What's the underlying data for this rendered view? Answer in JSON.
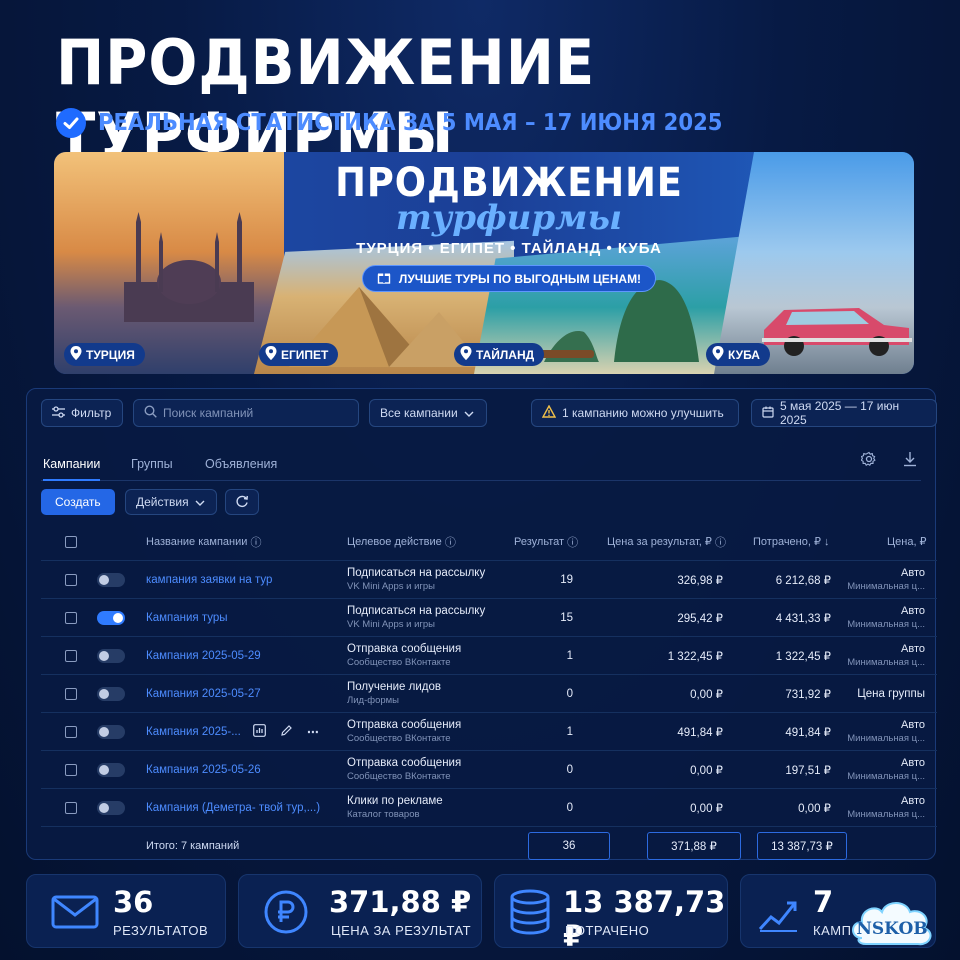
{
  "header": {
    "title": "ПРОДВИЖЕНИЕ ТУРФИРМЫ",
    "subtitle": "РЕАЛЬНАЯ СТАТИСТИКА ЗА 5 МАЯ – 17 ИЮНЯ 2025"
  },
  "banner": {
    "title_line1": "ПРОДВИЖЕНИЕ",
    "title_line2": "турфирмы",
    "countries": "ТУРЦИЯ • ЕГИПЕТ • ТАЙЛАНД • КУБА",
    "promo": "ЛУЧШИЕ ТУРЫ ПО ВЫГОДНЫМ ЦЕНАМ!",
    "locations": [
      "ТУРЦИЯ",
      "ЕГИПЕТ",
      "ТАЙЛАНД",
      "КУБА"
    ]
  },
  "toolbar": {
    "filter_label": "Фильтр",
    "search_placeholder": "Поиск кампаний",
    "campaign_select": "Все кампании",
    "improve_notice": "1 кампанию можно улучшить",
    "date_range": "5 мая 2025 — 17 июн 2025"
  },
  "tabs": [
    "Кампании",
    "Группы",
    "Объявления"
  ],
  "actions": {
    "create": "Создать",
    "actions": "Действия"
  },
  "table": {
    "headers": {
      "name": "Название кампании",
      "target": "Целевое действие",
      "result": "Результат",
      "cost_per_result": "Цена за результат, ₽",
      "spent": "Потрачено, ₽ ↓",
      "price": "Цена, ₽"
    },
    "rows": [
      {
        "name": "кампания заявки на тур",
        "target": "Подписаться на рассылку",
        "target_sub": "VK Mini Apps и игры",
        "result": "19",
        "cpr": "326,98 ₽",
        "spent": "6 212,68 ₽",
        "price": "Авто",
        "price_sub": "Минимальная ц...",
        "enabled": false
      },
      {
        "name": "Кампания туры",
        "target": "Подписаться на рассылку",
        "target_sub": "VK Mini Apps и игры",
        "result": "15",
        "cpr": "295,42 ₽",
        "spent": "4 431,33 ₽",
        "price": "Авто",
        "price_sub": "Минимальная ц...",
        "enabled": true
      },
      {
        "name": "Кампания 2025-05-29",
        "target": "Отправка сообщения",
        "target_sub": "Сообщество ВКонтакте",
        "result": "1",
        "cpr": "1 322,45 ₽",
        "spent": "1 322,45 ₽",
        "price": "Авто",
        "price_sub": "Минимальная ц...",
        "enabled": false
      },
      {
        "name": "Кампания 2025-05-27",
        "target": "Получение лидов",
        "target_sub": "Лид-формы",
        "result": "0",
        "cpr": "0,00 ₽",
        "spent": "731,92 ₽",
        "price": "Цена группы",
        "price_sub": "",
        "enabled": false
      },
      {
        "name": "Кампания 2025-...",
        "target": "Отправка сообщения",
        "target_sub": "Сообщество ВКонтакте",
        "result": "1",
        "cpr": "491,84 ₽",
        "spent": "491,84 ₽",
        "price": "Авто",
        "price_sub": "Минимальная ц...",
        "enabled": false
      },
      {
        "name": "Кампания 2025-05-26",
        "target": "Отправка сообщения",
        "target_sub": "Сообщество ВКонтакте",
        "result": "0",
        "cpr": "0,00 ₽",
        "spent": "197,51 ₽",
        "price": "Авто",
        "price_sub": "Минимальная ц...",
        "enabled": false
      },
      {
        "name": "Кампания (Деметра- твой тур,...)",
        "target": "Клики по рекламе",
        "target_sub": "Каталог товаров",
        "result": "0",
        "cpr": "0,00 ₽",
        "spent": "0,00 ₽",
        "price": "Авто",
        "price_sub": "Минимальная ц...",
        "enabled": false
      }
    ],
    "total_label": "Итого: 7 кампаний",
    "total_result": "36",
    "total_cpr": "371,88 ₽",
    "total_spent": "13 387,73 ₽"
  },
  "stats": [
    {
      "value": "36",
      "label": "РЕЗУЛЬТАТОВ",
      "icon": "envelope-icon"
    },
    {
      "value": "371,88 ₽",
      "label": "ЦЕНА ЗА РЕЗУЛЬТАТ",
      "icon": "ruble-coin-icon"
    },
    {
      "value": "13 387,73 ₽",
      "label": "ПОТРАЧЕНО",
      "icon": "coins-stack-icon"
    },
    {
      "value": "7",
      "label": "КАМП",
      "icon": "growth-chart-icon"
    }
  ],
  "watermark": "NSKOB",
  "colors": {
    "accent": "#2f7bff",
    "link": "#4d8cff",
    "bg": "#071a44"
  }
}
